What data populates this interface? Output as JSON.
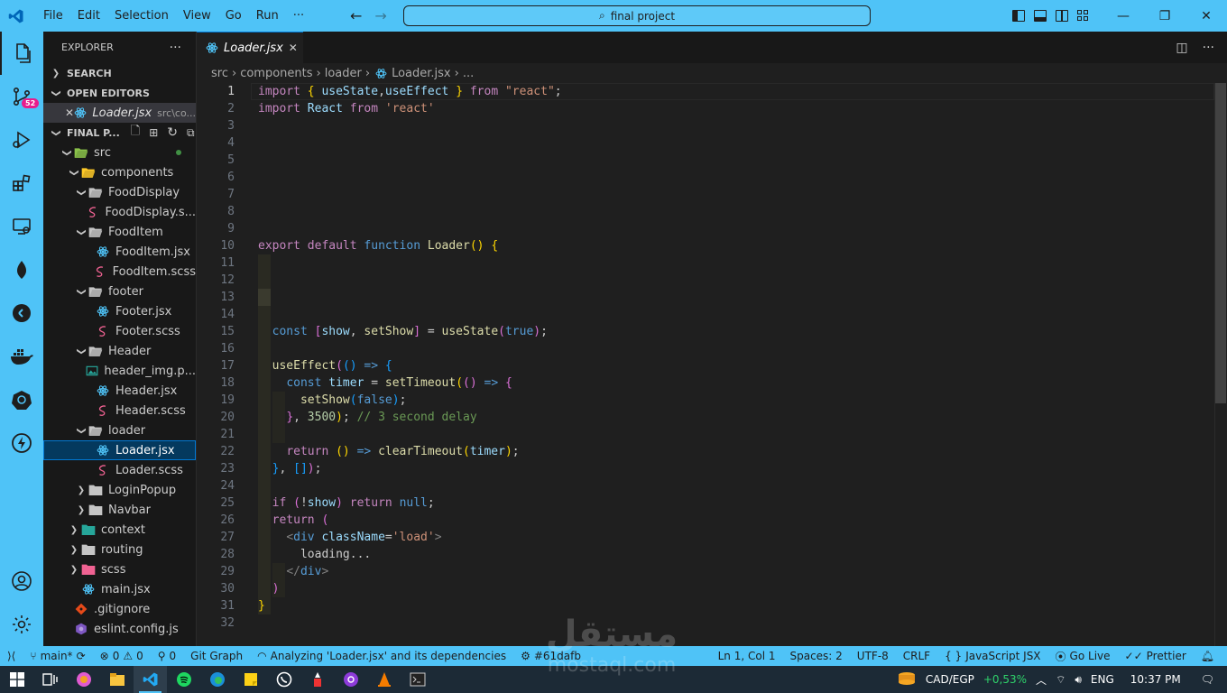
{
  "menu": {
    "file": "File",
    "edit": "Edit",
    "selection": "Selection",
    "view": "View",
    "go": "Go",
    "run": "Run",
    "more": "···"
  },
  "command_center": {
    "text": "final project"
  },
  "activity": {
    "scm_badge": "52"
  },
  "explorer": {
    "title": "EXPLORER",
    "more": "···",
    "search_section": "SEARCH",
    "open_editors_section": "OPEN EDITORS",
    "open_editor": {
      "name": "Loader.jsx",
      "path": "src\\co..."
    },
    "project_section": "FINAL P...",
    "tree": [
      {
        "label": "src",
        "depth": 1,
        "kind": "folder-open",
        "icon": "src-folder-icon",
        "color": "#8bc34a"
      },
      {
        "label": "components",
        "depth": 2,
        "kind": "folder-open",
        "icon": "components-folder-icon",
        "color": "#ffca28"
      },
      {
        "label": "FoodDisplay",
        "depth": 3,
        "kind": "folder-open",
        "icon": "folder-open-icon",
        "color": "#c5c5c5"
      },
      {
        "label": "FoodDisplay.s...",
        "depth": 4,
        "kind": "file",
        "icon": "scss-icon",
        "color": "#f06292"
      },
      {
        "label": "FoodItem",
        "depth": 3,
        "kind": "folder-open",
        "icon": "folder-open-icon",
        "color": "#c5c5c5"
      },
      {
        "label": "FoodItem.jsx",
        "depth": 4,
        "kind": "file",
        "icon": "react-icon",
        "color": "#4fc3f7"
      },
      {
        "label": "FoodItem.scss",
        "depth": 4,
        "kind": "file",
        "icon": "scss-icon",
        "color": "#f06292"
      },
      {
        "label": "footer",
        "depth": 3,
        "kind": "folder-open",
        "icon": "folder-open-icon",
        "color": "#c5c5c5"
      },
      {
        "label": "Footer.jsx",
        "depth": 4,
        "kind": "file",
        "icon": "react-icon",
        "color": "#4fc3f7"
      },
      {
        "label": "Footer.scss",
        "depth": 4,
        "kind": "file",
        "icon": "scss-icon",
        "color": "#f06292"
      },
      {
        "label": "Header",
        "depth": 3,
        "kind": "folder-open",
        "icon": "folder-open-icon",
        "color": "#c5c5c5"
      },
      {
        "label": "header_img.p...",
        "depth": 4,
        "kind": "file",
        "icon": "image-icon",
        "color": "#26a69a"
      },
      {
        "label": "Header.jsx",
        "depth": 4,
        "kind": "file",
        "icon": "react-icon",
        "color": "#4fc3f7"
      },
      {
        "label": "Header.scss",
        "depth": 4,
        "kind": "file",
        "icon": "scss-icon",
        "color": "#f06292"
      },
      {
        "label": "loader",
        "depth": 3,
        "kind": "folder-open",
        "icon": "folder-open-icon",
        "color": "#c5c5c5"
      },
      {
        "label": "Loader.jsx",
        "depth": 4,
        "kind": "file",
        "icon": "react-icon",
        "color": "#4fc3f7",
        "selected": true
      },
      {
        "label": "Loader.scss",
        "depth": 4,
        "kind": "file",
        "icon": "scss-icon",
        "color": "#f06292"
      },
      {
        "label": "LoginPopup",
        "depth": 3,
        "kind": "folder",
        "icon": "folder-icon",
        "color": "#c5c5c5"
      },
      {
        "label": "Navbar",
        "depth": 3,
        "kind": "folder",
        "icon": "folder-icon",
        "color": "#c5c5c5"
      },
      {
        "label": "context",
        "depth": 2,
        "kind": "folder",
        "icon": "context-folder-icon",
        "color": "#26a69a"
      },
      {
        "label": "routing",
        "depth": 2,
        "kind": "folder",
        "icon": "folder-icon",
        "color": "#c5c5c5"
      },
      {
        "label": "scss",
        "depth": 2,
        "kind": "folder",
        "icon": "scss-folder-icon",
        "color": "#f06292"
      },
      {
        "label": "main.jsx",
        "depth": 2,
        "kind": "file",
        "icon": "react-icon",
        "color": "#4fc3f7"
      },
      {
        "label": ".gitignore",
        "depth": 1,
        "kind": "file",
        "icon": "git-icon",
        "color": "#e64a19"
      },
      {
        "label": "eslint.config.js",
        "depth": 1,
        "kind": "file",
        "icon": "eslint-icon",
        "color": "#7e57c2"
      }
    ]
  },
  "tab": {
    "name": "Loader.jsx",
    "close": "✕"
  },
  "breadcrumb": {
    "p1": "src",
    "p2": "components",
    "p3": "loader",
    "p4": "Loader.jsx",
    "p5": "..."
  },
  "code": {
    "lines": [
      [
        [
          "kp",
          "import"
        ],
        [
          "txt",
          " "
        ],
        [
          "br1",
          "{"
        ],
        [
          "txt",
          " "
        ],
        [
          "var",
          "useState"
        ],
        [
          "txt",
          ","
        ],
        [
          "var",
          "useEffect"
        ],
        [
          "txt",
          " "
        ],
        [
          "br1",
          "}"
        ],
        [
          "txt",
          " "
        ],
        [
          "kp",
          "from"
        ],
        [
          "txt",
          " "
        ],
        [
          "str",
          "\"react\""
        ],
        [
          "txt",
          ";"
        ]
      ],
      [
        [
          "kp",
          "import"
        ],
        [
          "txt",
          " "
        ],
        [
          "var",
          "React"
        ],
        [
          "txt",
          " "
        ],
        [
          "kp",
          "from"
        ],
        [
          "txt",
          " "
        ],
        [
          "str",
          "'react'"
        ]
      ],
      [],
      [],
      [],
      [],
      [],
      [],
      [],
      [
        [
          "kp",
          "export"
        ],
        [
          "txt",
          " "
        ],
        [
          "kp",
          "default"
        ],
        [
          "txt",
          " "
        ],
        [
          "kw",
          "function"
        ],
        [
          "txt",
          " "
        ],
        [
          "fn",
          "Loader"
        ],
        [
          "br1",
          "()"
        ],
        [
          "txt",
          " "
        ],
        [
          "br1",
          "{"
        ]
      ],
      [],
      [],
      [],
      [],
      [
        [
          "txt",
          "  "
        ],
        [
          "kw",
          "const"
        ],
        [
          "txt",
          " "
        ],
        [
          "br2",
          "["
        ],
        [
          "var",
          "show"
        ],
        [
          "txt",
          ", "
        ],
        [
          "fn",
          "setShow"
        ],
        [
          "br2",
          "]"
        ],
        [
          "txt",
          " = "
        ],
        [
          "fn",
          "useState"
        ],
        [
          "br2",
          "("
        ],
        [
          "kw",
          "true"
        ],
        [
          "br2",
          ")"
        ],
        [
          "txt",
          ";"
        ]
      ],
      [],
      [
        [
          "txt",
          "  "
        ],
        [
          "fn",
          "useEffect"
        ],
        [
          "br2",
          "("
        ],
        [
          "br3",
          "()"
        ],
        [
          "txt",
          " "
        ],
        [
          "kw",
          "=>"
        ],
        [
          "txt",
          " "
        ],
        [
          "br3",
          "{"
        ]
      ],
      [
        [
          "txt",
          "    "
        ],
        [
          "kw",
          "const"
        ],
        [
          "txt",
          " "
        ],
        [
          "var",
          "timer"
        ],
        [
          "txt",
          " = "
        ],
        [
          "fn",
          "setTimeout"
        ],
        [
          "br1",
          "("
        ],
        [
          "br2",
          "()"
        ],
        [
          "txt",
          " "
        ],
        [
          "kw",
          "=>"
        ],
        [
          "txt",
          " "
        ],
        [
          "br2",
          "{"
        ]
      ],
      [
        [
          "txt",
          "      "
        ],
        [
          "fn",
          "setShow"
        ],
        [
          "br3",
          "("
        ],
        [
          "kw",
          "false"
        ],
        [
          "br3",
          ")"
        ],
        [
          "txt",
          ";"
        ]
      ],
      [
        [
          "txt",
          "    "
        ],
        [
          "br2",
          "}"
        ],
        [
          "txt",
          ", "
        ],
        [
          "num",
          "3500"
        ],
        [
          "br1",
          ")"
        ],
        [
          "txt",
          "; "
        ],
        [
          "cm",
          "// 3 second delay"
        ]
      ],
      [],
      [
        [
          "txt",
          "    "
        ],
        [
          "kp",
          "return"
        ],
        [
          "txt",
          " "
        ],
        [
          "br1",
          "()"
        ],
        [
          "txt",
          " "
        ],
        [
          "kw",
          "=>"
        ],
        [
          "txt",
          " "
        ],
        [
          "fn",
          "clearTimeout"
        ],
        [
          "br1",
          "("
        ],
        [
          "var",
          "timer"
        ],
        [
          "br1",
          ")"
        ],
        [
          "txt",
          ";"
        ]
      ],
      [
        [
          "txt",
          "  "
        ],
        [
          "br3",
          "}"
        ],
        [
          "txt",
          ", "
        ],
        [
          "br3",
          "[]"
        ],
        [
          "br2",
          ")"
        ],
        [
          "txt",
          ";"
        ]
      ],
      [],
      [
        [
          "txt",
          "  "
        ],
        [
          "kp",
          "if"
        ],
        [
          "txt",
          " "
        ],
        [
          "br2",
          "("
        ],
        [
          "txt",
          "!"
        ],
        [
          "var",
          "show"
        ],
        [
          "br2",
          ")"
        ],
        [
          "txt",
          " "
        ],
        [
          "kp",
          "return"
        ],
        [
          "txt",
          " "
        ],
        [
          "kw",
          "null"
        ],
        [
          "txt",
          ";"
        ]
      ],
      [
        [
          "txt",
          "  "
        ],
        [
          "kp",
          "return"
        ],
        [
          "txt",
          " "
        ],
        [
          "br2",
          "("
        ]
      ],
      [
        [
          "txt",
          "    "
        ],
        [
          "tag",
          "<"
        ],
        [
          "tagn",
          "div"
        ],
        [
          "txt",
          " "
        ],
        [
          "attr",
          "className"
        ],
        [
          "txt",
          "="
        ],
        [
          "str",
          "'load'"
        ],
        [
          "tag",
          ">"
        ]
      ],
      [
        [
          "txt",
          "      loading..."
        ]
      ],
      [
        [
          "txt",
          "    "
        ],
        [
          "tag",
          "</"
        ],
        [
          "tagn",
          "div"
        ],
        [
          "tag",
          ">"
        ]
      ],
      [
        [
          "txt",
          "  "
        ],
        [
          "br2",
          ")"
        ]
      ],
      [
        [
          "br1",
          "}"
        ]
      ],
      []
    ]
  },
  "status": {
    "remote": "⟩⟨",
    "branch": "main*",
    "errors": "0",
    "warnings": "0",
    "info": "0",
    "git_graph": "Git Graph",
    "analyzing": "Analyzing 'Loader.jsx' and its dependencies",
    "commit": "#61dafb",
    "position": "Ln 1, Col 1",
    "spaces": "Spaces: 2",
    "encoding": "UTF-8",
    "eol": "CRLF",
    "braces": "{ }",
    "language": "JavaScript JSX",
    "golive": "Go Live",
    "prettier": "Prettier"
  },
  "taskbar": {
    "currency": "CAD/EGP",
    "change": "+0,53%",
    "lang": "ENG",
    "time": "10:37 PM"
  },
  "watermark": {
    "arabic": "مستقل",
    "latin": "mostaql.com"
  }
}
